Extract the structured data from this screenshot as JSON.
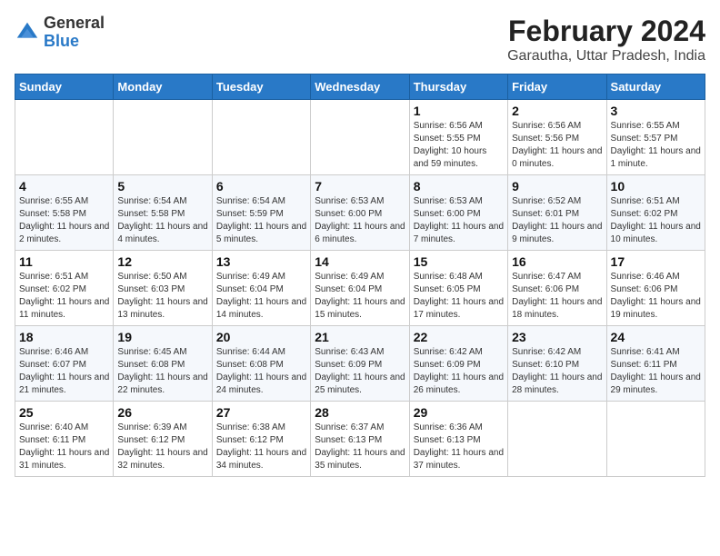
{
  "logo": {
    "text1": "General",
    "text2": "Blue"
  },
  "title": "February 2024",
  "subtitle": "Garautha, Uttar Pradesh, India",
  "days_of_week": [
    "Sunday",
    "Monday",
    "Tuesday",
    "Wednesday",
    "Thursday",
    "Friday",
    "Saturday"
  ],
  "weeks": [
    [
      {
        "day": "",
        "info": ""
      },
      {
        "day": "",
        "info": ""
      },
      {
        "day": "",
        "info": ""
      },
      {
        "day": "",
        "info": ""
      },
      {
        "day": "1",
        "info": "Sunrise: 6:56 AM\nSunset: 5:55 PM\nDaylight: 10 hours and 59 minutes."
      },
      {
        "day": "2",
        "info": "Sunrise: 6:56 AM\nSunset: 5:56 PM\nDaylight: 11 hours and 0 minutes."
      },
      {
        "day": "3",
        "info": "Sunrise: 6:55 AM\nSunset: 5:57 PM\nDaylight: 11 hours and 1 minute."
      }
    ],
    [
      {
        "day": "4",
        "info": "Sunrise: 6:55 AM\nSunset: 5:58 PM\nDaylight: 11 hours and 2 minutes."
      },
      {
        "day": "5",
        "info": "Sunrise: 6:54 AM\nSunset: 5:58 PM\nDaylight: 11 hours and 4 minutes."
      },
      {
        "day": "6",
        "info": "Sunrise: 6:54 AM\nSunset: 5:59 PM\nDaylight: 11 hours and 5 minutes."
      },
      {
        "day": "7",
        "info": "Sunrise: 6:53 AM\nSunset: 6:00 PM\nDaylight: 11 hours and 6 minutes."
      },
      {
        "day": "8",
        "info": "Sunrise: 6:53 AM\nSunset: 6:00 PM\nDaylight: 11 hours and 7 minutes."
      },
      {
        "day": "9",
        "info": "Sunrise: 6:52 AM\nSunset: 6:01 PM\nDaylight: 11 hours and 9 minutes."
      },
      {
        "day": "10",
        "info": "Sunrise: 6:51 AM\nSunset: 6:02 PM\nDaylight: 11 hours and 10 minutes."
      }
    ],
    [
      {
        "day": "11",
        "info": "Sunrise: 6:51 AM\nSunset: 6:02 PM\nDaylight: 11 hours and 11 minutes."
      },
      {
        "day": "12",
        "info": "Sunrise: 6:50 AM\nSunset: 6:03 PM\nDaylight: 11 hours and 13 minutes."
      },
      {
        "day": "13",
        "info": "Sunrise: 6:49 AM\nSunset: 6:04 PM\nDaylight: 11 hours and 14 minutes."
      },
      {
        "day": "14",
        "info": "Sunrise: 6:49 AM\nSunset: 6:04 PM\nDaylight: 11 hours and 15 minutes."
      },
      {
        "day": "15",
        "info": "Sunrise: 6:48 AM\nSunset: 6:05 PM\nDaylight: 11 hours and 17 minutes."
      },
      {
        "day": "16",
        "info": "Sunrise: 6:47 AM\nSunset: 6:06 PM\nDaylight: 11 hours and 18 minutes."
      },
      {
        "day": "17",
        "info": "Sunrise: 6:46 AM\nSunset: 6:06 PM\nDaylight: 11 hours and 19 minutes."
      }
    ],
    [
      {
        "day": "18",
        "info": "Sunrise: 6:46 AM\nSunset: 6:07 PM\nDaylight: 11 hours and 21 minutes."
      },
      {
        "day": "19",
        "info": "Sunrise: 6:45 AM\nSunset: 6:08 PM\nDaylight: 11 hours and 22 minutes."
      },
      {
        "day": "20",
        "info": "Sunrise: 6:44 AM\nSunset: 6:08 PM\nDaylight: 11 hours and 24 minutes."
      },
      {
        "day": "21",
        "info": "Sunrise: 6:43 AM\nSunset: 6:09 PM\nDaylight: 11 hours and 25 minutes."
      },
      {
        "day": "22",
        "info": "Sunrise: 6:42 AM\nSunset: 6:09 PM\nDaylight: 11 hours and 26 minutes."
      },
      {
        "day": "23",
        "info": "Sunrise: 6:42 AM\nSunset: 6:10 PM\nDaylight: 11 hours and 28 minutes."
      },
      {
        "day": "24",
        "info": "Sunrise: 6:41 AM\nSunset: 6:11 PM\nDaylight: 11 hours and 29 minutes."
      }
    ],
    [
      {
        "day": "25",
        "info": "Sunrise: 6:40 AM\nSunset: 6:11 PM\nDaylight: 11 hours and 31 minutes."
      },
      {
        "day": "26",
        "info": "Sunrise: 6:39 AM\nSunset: 6:12 PM\nDaylight: 11 hours and 32 minutes."
      },
      {
        "day": "27",
        "info": "Sunrise: 6:38 AM\nSunset: 6:12 PM\nDaylight: 11 hours and 34 minutes."
      },
      {
        "day": "28",
        "info": "Sunrise: 6:37 AM\nSunset: 6:13 PM\nDaylight: 11 hours and 35 minutes."
      },
      {
        "day": "29",
        "info": "Sunrise: 6:36 AM\nSunset: 6:13 PM\nDaylight: 11 hours and 37 minutes."
      },
      {
        "day": "",
        "info": ""
      },
      {
        "day": "",
        "info": ""
      }
    ]
  ]
}
